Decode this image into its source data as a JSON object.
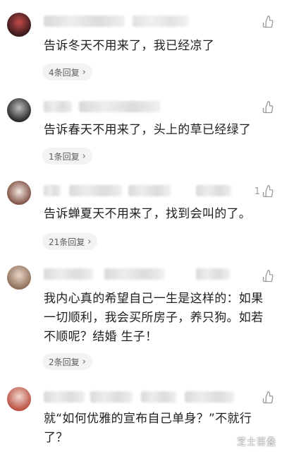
{
  "comments": [
    {
      "avatar_icon": "avatar-dark-figure",
      "likes": "",
      "text": "告诉冬天不用来了，我已经凉了",
      "replies": "4条回复"
    },
    {
      "avatar_icon": "avatar-person-dark",
      "likes": "",
      "text": "告诉春天不用来了，头上的草已经绿了",
      "replies": "1条回复"
    },
    {
      "avatar_icon": "avatar-cartoon",
      "likes": "1",
      "text": "告诉蝉夏天不用来了，找到会叫的了。",
      "replies": "21条回复"
    },
    {
      "avatar_icon": "avatar-person-light",
      "likes": "",
      "text": "我内心真的希望自己一生是这样的：如果一切顺利，我会买所房子，养只狗。如若不顺呢？结婚 生子！",
      "replies": "2条回复"
    },
    {
      "avatar_icon": "avatar-person-red",
      "likes": "",
      "text": "就“如何优雅的宣布自己单身？”不就行了？",
      "replies": ""
    }
  ],
  "watermark": "芝士百叠",
  "colors": {
    "background": "#ffffff",
    "text": "#1f1f1f",
    "meta": "#9a9a9a",
    "reply_pill": "#f3f3f3"
  }
}
